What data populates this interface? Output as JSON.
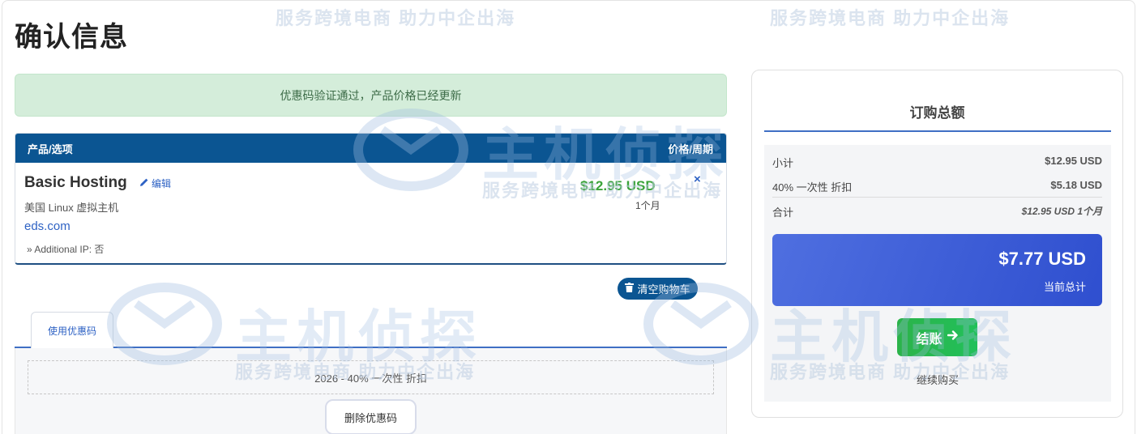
{
  "page": {
    "title": "确认信息"
  },
  "alert": {
    "text": "优惠码验证通过，产品价格已经更新"
  },
  "cart": {
    "header": {
      "product_col": "产品/选项",
      "price_col": "价格/周期"
    },
    "items": [
      {
        "name": "Basic Hosting",
        "edit_label": "编辑",
        "group": "美国 Linux 虚拟主机",
        "domain": "eds.com",
        "option": "» Additional IP: 否",
        "price": "$12.95 USD",
        "cycle": "1个月",
        "remove_symbol": "×"
      }
    ],
    "empty_label": "清空购物车"
  },
  "promo": {
    "tab_label": "使用优惠码",
    "applied_text": "2026 - 40% 一次性 折扣",
    "remove_label": "删除优惠码"
  },
  "summary": {
    "title": "订购总额",
    "subtotal_label": "小计",
    "subtotal_value": "$12.95 USD",
    "discount_label": "40% 一次性 折扣",
    "discount_value": "$5.18 USD",
    "total_label": "合计",
    "total_value": "$12.95 USD 1个月",
    "grand_total": "$7.77 USD",
    "grand_total_label": "当前总计",
    "checkout_label": "结账",
    "continue_label": "继续购买"
  },
  "watermark": {
    "slogan": "服务跨境电商 助力中企出海",
    "brand": "主机侦探"
  },
  "colors": {
    "header_bg": "#0b5592",
    "accent_blue": "#3f6fc4",
    "price_green": "#3aa33a",
    "alert_bg": "#d4edda",
    "checkout_green": "#2bb34a",
    "total_gradient_start": "#4f6fe0",
    "total_gradient_end": "#2f4fcf"
  }
}
